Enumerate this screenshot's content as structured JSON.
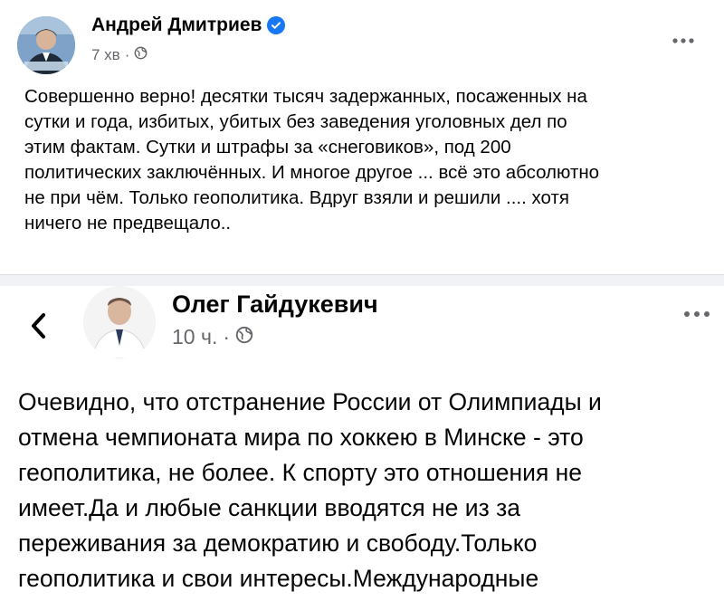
{
  "post_top": {
    "author": "Андрей Дмитриев",
    "time": "7 хв",
    "separator": "·",
    "lines": [
      "Совершенно верно! десятки тысяч задержанных, посаженных на",
      "сутки и года, избитых, убитых без заведения уголовных дел по",
      "этим фактам. Сутки и штрафы за «снеговиков», под 200",
      "политических заключённых. И многое другое ... всё это абсолютно",
      "не при чём. Только геополитика. Вдруг взяли и решили .... хотя",
      "ничего не предвещало.."
    ]
  },
  "post_shared": {
    "author": "Олег Гайдукевич",
    "time": "10 ч.",
    "separator": "·",
    "lines": [
      "Очевидно, что отстранение России от Олимпиады и",
      "отмена чемпионата мира по хоккею в Минске - это",
      "геополитика, не более. К спорту это отношения не",
      "имеет.Да и любые санкции вводятся не из за",
      "переживания за демократию и свободу.Только",
      "геополитика  и свои интересы.Международные"
    ]
  },
  "icons": {
    "verified": "verified-badge-icon",
    "audience_top": "public-globe-icon",
    "audience_shared": "public-globe-icon",
    "more": "more-options-icon",
    "back": "chevron-left-icon"
  },
  "colors": {
    "verified": "#1877f2",
    "secondary_text": "#65676b",
    "divider": "#f0f2f5"
  }
}
